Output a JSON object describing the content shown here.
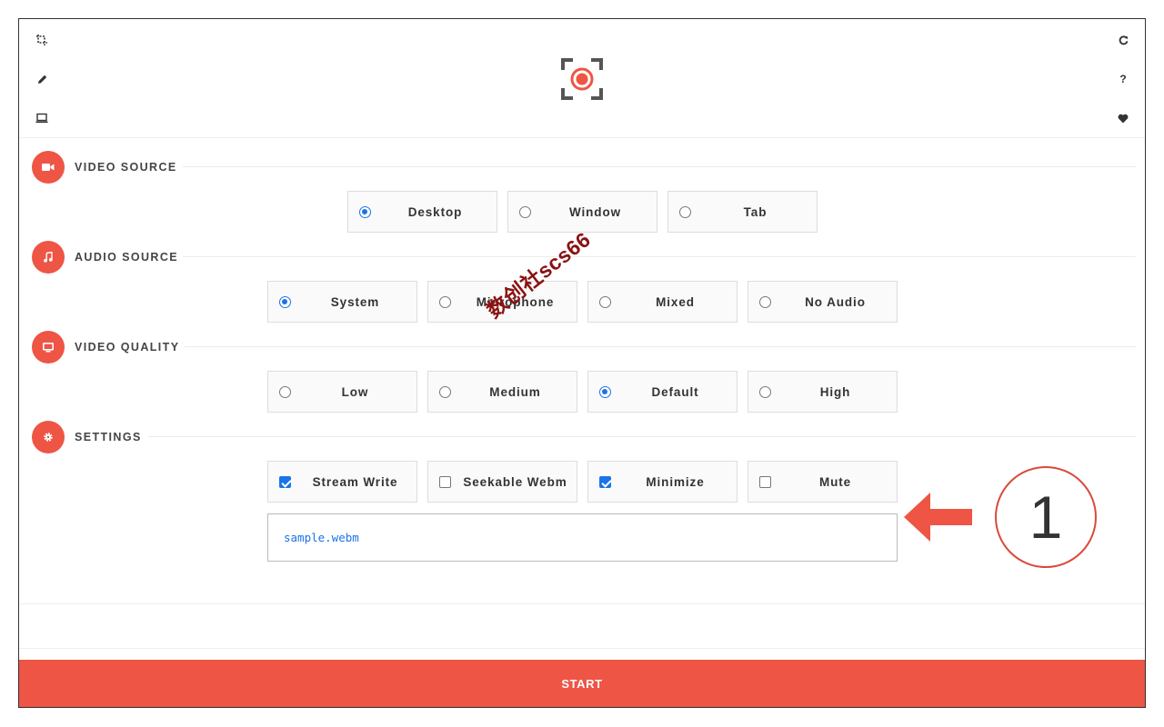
{
  "toolbar": {
    "left_icons": [
      "crop-icon",
      "pencil-icon",
      "laptop-icon"
    ],
    "right_icons": [
      "refresh-icon",
      "help-icon",
      "heart-icon"
    ],
    "help_glyph": "?"
  },
  "logo": {
    "icon": "record-target-icon",
    "accent": "#ee5544",
    "frame": "#555555"
  },
  "sections": {
    "video_source": {
      "title": "VIDEO SOURCE",
      "icon": "video-camera-icon",
      "options": [
        {
          "label": "Desktop",
          "selected": true
        },
        {
          "label": "Window",
          "selected": false
        },
        {
          "label": "Tab",
          "selected": false
        }
      ]
    },
    "audio_source": {
      "title": "AUDIO SOURCE",
      "icon": "music-note-icon",
      "options": [
        {
          "label": "System",
          "selected": true
        },
        {
          "label": "Microphone",
          "selected": false
        },
        {
          "label": "Mixed",
          "selected": false
        },
        {
          "label": "No Audio",
          "selected": false
        }
      ]
    },
    "video_quality": {
      "title": "VIDEO QUALITY",
      "icon": "monitor-icon",
      "options": [
        {
          "label": "Low",
          "selected": false
        },
        {
          "label": "Medium",
          "selected": false
        },
        {
          "label": "Default",
          "selected": true
        },
        {
          "label": "High",
          "selected": false
        }
      ]
    },
    "settings": {
      "title": "SETTINGS",
      "icon": "gear-icon",
      "options": [
        {
          "label": "Stream Write",
          "checked": true
        },
        {
          "label": "Seekable Webm",
          "checked": false
        },
        {
          "label": "Minimize",
          "checked": true
        },
        {
          "label": "Mute",
          "checked": false
        }
      ],
      "filename_value": "sample.webm"
    }
  },
  "start_button": {
    "label": "START",
    "color": "#ee5544"
  },
  "annotation": {
    "number": "1",
    "color": "#ee5544"
  },
  "watermark": {
    "text": "数创社scs66"
  },
  "colors": {
    "accent": "#ee5544",
    "control_blue": "#1a73e8"
  }
}
